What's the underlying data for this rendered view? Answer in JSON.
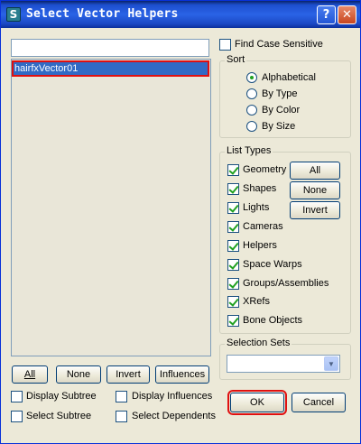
{
  "window": {
    "title": "Select Vector Helpers",
    "help_glyph": "?",
    "close_glyph": "✕",
    "icon_glyph": "S"
  },
  "filter": {
    "value": ""
  },
  "list": {
    "items": [
      "hairfxVector01"
    ]
  },
  "list_buttons": {
    "all": "All",
    "none": "None",
    "invert": "Invert",
    "influences": "Influences"
  },
  "options": {
    "display_subtree": "Display Subtree",
    "display_influences": "Display Influences",
    "select_subtree": "Select Subtree",
    "select_dependents": "Select Dependents"
  },
  "find_case_sensitive": {
    "label": "Find Case Sensitive",
    "checked": false
  },
  "sort": {
    "title": "Sort",
    "options": [
      "Alphabetical",
      "By Type",
      "By Color",
      "By Size"
    ],
    "selected": "Alphabetical"
  },
  "list_types": {
    "title": "List Types",
    "items": [
      "Geometry",
      "Shapes",
      "Lights",
      "Cameras",
      "Helpers",
      "Space Warps",
      "Groups/Assemblies",
      "XRefs",
      "Bone Objects"
    ],
    "all": "All",
    "none": "None",
    "invert": "Invert"
  },
  "selection_sets": {
    "title": "Selection Sets",
    "value": "",
    "arrow": "▼"
  },
  "dialog_buttons": {
    "ok": "OK",
    "cancel": "Cancel"
  },
  "colors": {
    "titlebar": "#2a63e6",
    "selection": "#316ac5",
    "highlight": "#e01010",
    "face": "#ece9d8"
  }
}
